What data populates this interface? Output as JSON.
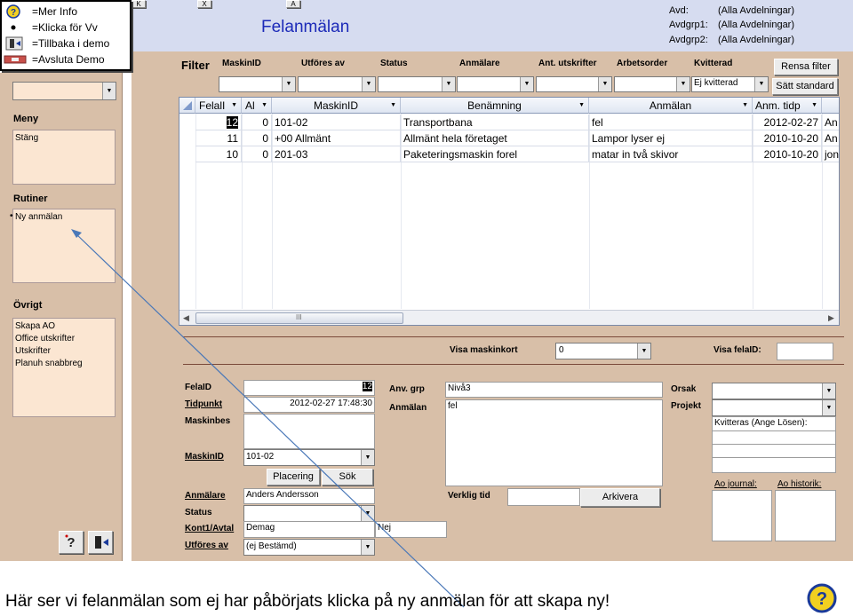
{
  "legend": {
    "help": "=Mer Info",
    "click": "=Klicka för Vv",
    "back": "=Tillbaka i demo",
    "exit": "=Avsluta Demo"
  },
  "tabs": [
    "K",
    "X",
    "A"
  ],
  "header": {
    "title": "Felanmälan",
    "avd_label": "Avd:",
    "avd_value": "(Alla Avdelningar)",
    "avdgrp1_label": "Avdgrp1:",
    "avdgrp1_value": "(Alla Avdelningar)",
    "avdgrp2_label": "Avdgrp2:",
    "avdgrp2_value": "(Alla Avdelningar)"
  },
  "sidebar": {
    "meny_title": "Meny",
    "meny_items": [
      "Stäng"
    ],
    "rutiner_title": "Rutiner",
    "rutiner_items": [
      "Ny anmälan"
    ],
    "ovrigt_title": "Övrigt",
    "ovrigt_items": [
      "Skapa AO",
      "Office utskrifter",
      "Utskrifter",
      "Planuh snabbreg"
    ]
  },
  "filter": {
    "title": "Filter",
    "labels": [
      "MaskinID",
      "Utföres av",
      "Status",
      "Anmälare",
      "Ant. utskrifter",
      "Arbetsorder",
      "Kvitterad"
    ],
    "kvitterad_value": "Ej kvitterad",
    "rensa": "Rensa filter",
    "standard": "Sätt standard"
  },
  "grid": {
    "columns": [
      "FelalI",
      "Al",
      "MaskinID",
      "Benämning",
      "Anmälan",
      "Anm. tidp"
    ],
    "rows": [
      [
        "12",
        "0",
        "101-02",
        "Transportbana",
        "fel",
        "2012-02-27",
        "An"
      ],
      [
        "11",
        "0",
        "+00 Allmänt",
        "Allmänt hela företaget",
        "Lampor lyser ej",
        "2010-10-20",
        "An"
      ],
      [
        "10",
        "0",
        "201-03",
        "Paketeringsmaskin forel",
        "matar in två skivor",
        "2010-10-20",
        "jon"
      ]
    ],
    "hscroll_mark": "III"
  },
  "detail": {
    "visa_maskinkort": "Visa maskinkort",
    "maskinkort_value": "0",
    "visa_felaid": "Visa felaID:",
    "felaid_label": "FelaID",
    "felaid_value": "12",
    "tidpunkt_label": "Tidpunkt",
    "tidpunkt_value": "2012-02-27 17:48:30",
    "maskinbes_label": "Maskinbes",
    "maskinid_label": "MaskinID",
    "maskinid_value": "101-02",
    "placering": "Placering",
    "sok": "Sök",
    "anmalare_label": "Anmälare",
    "anmalare_value": "Anders Andersson",
    "status_label": "Status",
    "kont_label": "Kont1/Avtal",
    "kont_value": "Demag",
    "nej_value": "Nej",
    "utfores_label": "Utföres av",
    "utfores_value": "(ej Bestämd)",
    "anvgrp_label": "Anv. grp",
    "anvgrp_value": "Nivå3",
    "anmalan_label": "Anmälan",
    "anmalan_value": "fel",
    "verklig_label": "Verklig tid",
    "arkivera": "Arkivera",
    "orsak_label": "Orsak",
    "projekt_label": "Projekt",
    "kvitteras_label": "Kvitteras (Ange Lösen):",
    "ao_journal": "Ao journal:",
    "ao_historik": "Ao historik:"
  },
  "caption": "Här ser vi felanmälan som ej har påbörjats klicka på ny anmälan för att skapa ny!"
}
